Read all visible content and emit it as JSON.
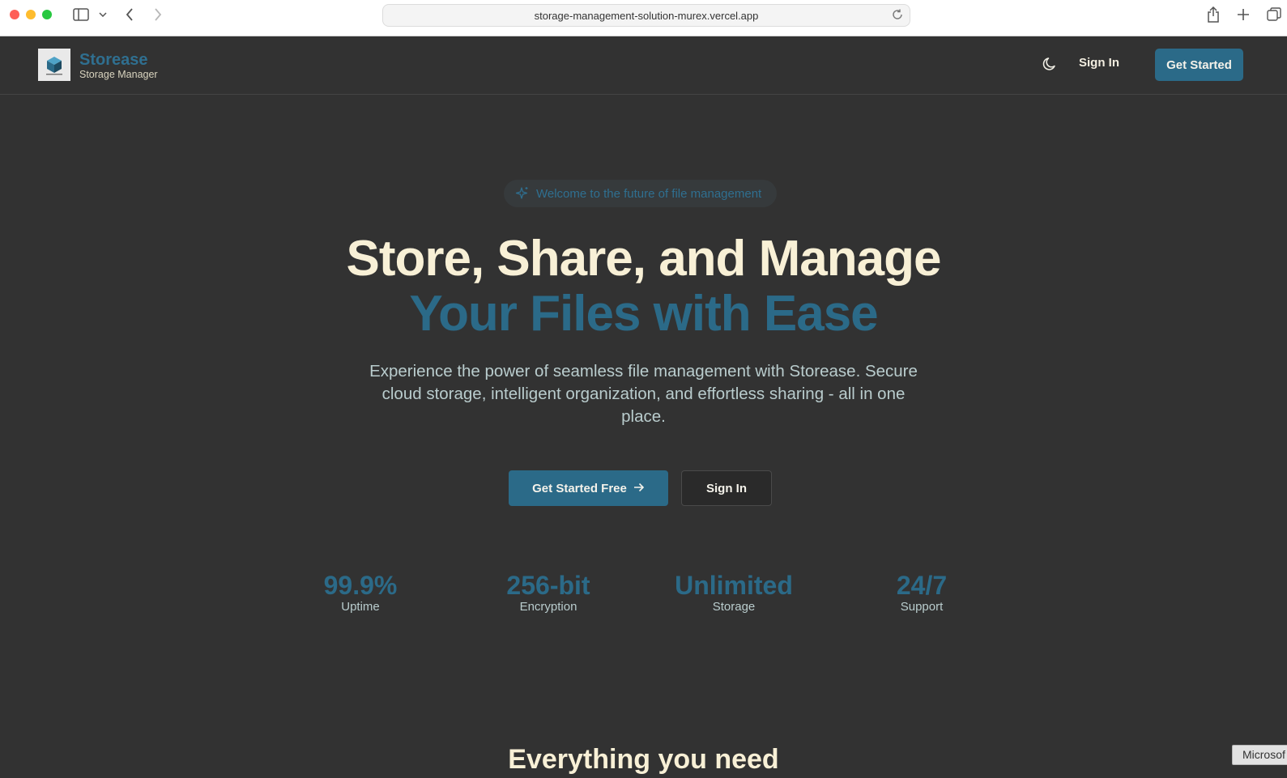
{
  "browser": {
    "url": "storage-management-solution-murex.vercel.app"
  },
  "header": {
    "brand_name": "Storease",
    "brand_subtitle": "Storage Manager",
    "sign_in_label": "Sign In",
    "get_started_label": "Get Started"
  },
  "hero": {
    "badge_text": "Welcome to the future of file management",
    "title_line1": "Store, Share, and Manage",
    "title_line2": "Your Files with Ease",
    "description": "Experience the power of seamless file management with Storease. Secure cloud storage, intelligent organization, and effortless sharing - all in one place.",
    "primary_button_label": "Get Started Free",
    "secondary_button_label": "Sign In"
  },
  "stats": [
    {
      "value": "99.9%",
      "label": "Uptime"
    },
    {
      "value": "256-bit",
      "label": "Encryption"
    },
    {
      "value": "Unlimited",
      "label": "Storage"
    },
    {
      "value": "24/7",
      "label": "Support"
    }
  ],
  "features": {
    "title": "Everything you need"
  },
  "tooltip": {
    "text": "Microsof"
  },
  "colors": {
    "background": "#323232",
    "accent": "#2b6a88",
    "heading": "#f8f0d6",
    "body_text": "#b9cccd"
  }
}
